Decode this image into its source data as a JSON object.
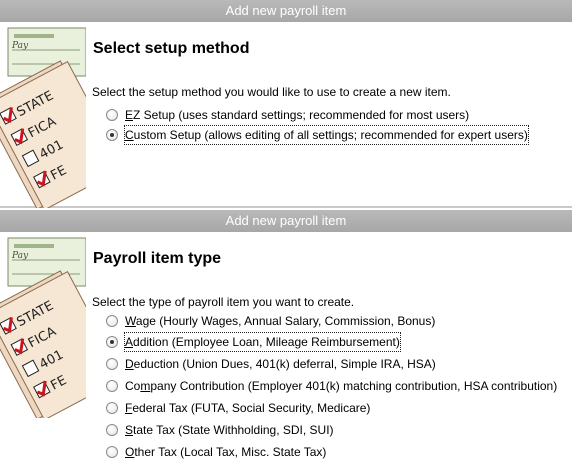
{
  "dialog1": {
    "title": "Add new payroll item",
    "heading": "Select setup method",
    "prompt": "Select the setup method you would like to use to create a new item.",
    "options": [
      {
        "mnemonic": "E",
        "rest": "Z Setup (uses standard settings; recommended for most users)",
        "selected": false
      },
      {
        "mnemonic": "C",
        "rest": "ustom Setup (allows editing of all settings; recommended for expert users)",
        "selected": true
      }
    ]
  },
  "dialog2": {
    "title": "Add new payroll item",
    "heading": "Payroll item type",
    "prompt": "Select the type of payroll item you want to create.",
    "options": [
      {
        "pre": "",
        "mnemonic": "W",
        "rest": "age (Hourly Wages, Annual Salary, Commission, Bonus)",
        "selected": false
      },
      {
        "pre": "",
        "mnemonic": "A",
        "rest": "ddition (Employee Loan, Mileage Reimbursement)",
        "selected": true
      },
      {
        "pre": "",
        "mnemonic": "D",
        "rest": "eduction (Union Dues, 401(k) deferral, Simple IRA, HSA)",
        "selected": false
      },
      {
        "pre": "Co",
        "mnemonic": "m",
        "rest": "pany Contribution (Employer 401(k) matching contribution, HSA contribution)",
        "selected": false
      },
      {
        "pre": "",
        "mnemonic": "F",
        "rest": "ederal Tax (FUTA, Social Security, Medicare)",
        "selected": false
      },
      {
        "pre": "",
        "mnemonic": "S",
        "rest": "tate Tax (State Withholding, SDI, SUI)",
        "selected": false
      },
      {
        "pre": "",
        "mnemonic": "O",
        "rest": "ther Tax (Local Tax, Misc. State Tax)",
        "selected": false
      }
    ]
  },
  "graphic": {
    "check_text": "Pay",
    "form_labels": [
      "STATE",
      "FICA",
      "401",
      "FE"
    ]
  }
}
